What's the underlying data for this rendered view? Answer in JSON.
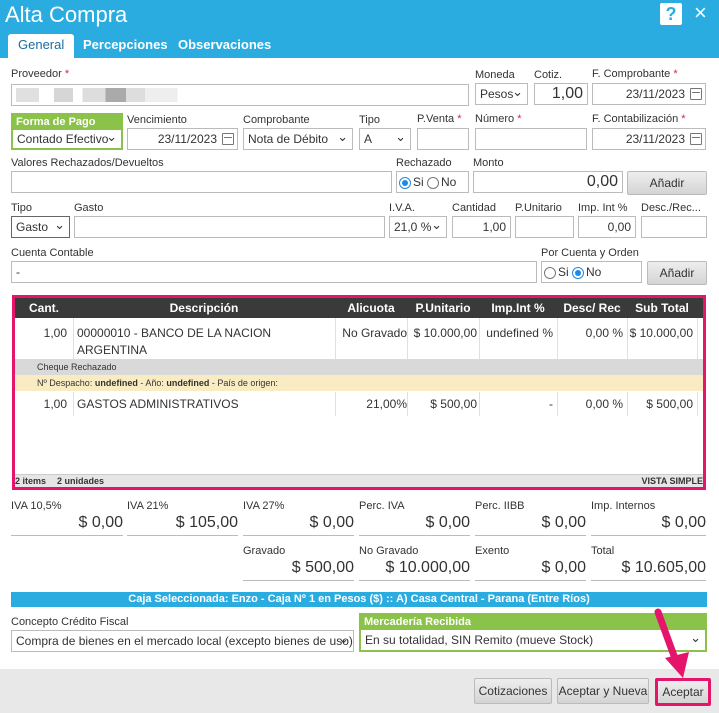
{
  "window": {
    "title": "Alta Compra",
    "help": "?",
    "close": "×"
  },
  "tabs": [
    "General",
    "Percepciones",
    "Observaciones"
  ],
  "labels": {
    "proveedor": "Proveedor",
    "moneda": "Moneda",
    "cotiz": "Cotiz.",
    "fcomp": "F. Comprobante",
    "formapago": "Forma de Pago",
    "venc": "Vencimiento",
    "comprobante": "Comprobante",
    "tipo": "Tipo",
    "pventa": "P.Venta",
    "numero": "Número",
    "fcont": "F. Contabilización",
    "valores": "Valores Rechazados/Devueltos",
    "rechazado": "Rechazado",
    "monto": "Monto",
    "tipo2": "Tipo",
    "gasto": "Gasto",
    "iva": "I.V.A.",
    "cantidad": "Cantidad",
    "punit": "P.Unitario",
    "impint": "Imp. Int %",
    "desc": "Desc./Rec...",
    "cuenta": "Cuenta Contable",
    "porcuenta": "Por Cuenta y Orden",
    "si": "Si",
    "no": "No"
  },
  "values": {
    "moneda": "Pesos",
    "cotiz": "1,00",
    "fcomp": "23/11/2023",
    "formapago": "Contado Efectivo",
    "venc": "23/11/2023",
    "comprobante": "Nota de Débito",
    "tipo": "A",
    "fcont": "23/11/2023",
    "monto": "0,00",
    "tipo2": "Gasto",
    "iva": "21,0 %",
    "cantidad": "1,00",
    "impint": "0,00",
    "cuenta": "-"
  },
  "buttons": {
    "anadir1": "Añadir",
    "anadir2": "Añadir",
    "cotizaciones": "Cotizaciones",
    "aceptarnueva": "Aceptar y Nueva",
    "aceptar": "Aceptar"
  },
  "grid": {
    "headers": [
      "Cant.",
      "Descripción",
      "Alicuota",
      "P.Unitario",
      "Imp.Int %",
      "Desc/ Rec",
      "Sub Total"
    ],
    "row1": {
      "cant": "1,00",
      "desc1": "00000010 - BANCO DE LA NACION",
      "desc2": "ARGENTINA",
      "alic": "No Gravado",
      "punit": "$ 10.000,00",
      "impint": "undefined %",
      "desc": "0,00 %",
      "sub": "$ 10.000,00"
    },
    "cheque": "Cheque Rechazado",
    "despacho": {
      "l1": "Nº Despacho: ",
      "v1": "undefined",
      "l2": " - Año: ",
      "v2": "undefined",
      "l3": " - País de origen:"
    },
    "row2": {
      "cant": "1,00",
      "desc": "GASTOS ADMINISTRATIVOS",
      "alic": "21,00%",
      "punit": "$ 500,00",
      "impint": "-",
      "desc2": "0,00 %",
      "sub": "$ 500,00"
    },
    "footer_items": "2 items",
    "footer_units": "2 unidades",
    "footer_view": "VISTA SIMPLE"
  },
  "totals": {
    "iva105_l": "IVA 10,5%",
    "iva105": "$ 0,00",
    "iva21_l": "IVA 21%",
    "iva21": "$ 105,00",
    "iva27_l": "IVA 27%",
    "iva27": "$ 0,00",
    "perciva_l": "Perc. IVA",
    "perciva": "$ 0,00",
    "perciibb_l": "Perc. IIBB",
    "perciibb": "$ 0,00",
    "impint_l": "Imp. Internos",
    "impint": "$ 0,00",
    "grav_l": "Gravado",
    "grav": "$ 500,00",
    "nograv_l": "No Gravado",
    "nograv": "$ 10.000,00",
    "exento_l": "Exento",
    "exento": "$ 0,00",
    "total_l": "Total",
    "total": "$ 10.605,00"
  },
  "caja": "Caja Seleccionada: Enzo - Caja Nº 1 en Pesos ($) :: A) Casa Central - Parana (Entre Ríos)",
  "concepto": {
    "label": "Concepto Crédito Fiscal",
    "value": "Compra de bienes en el mercado local (excepto bienes de uso)"
  },
  "mercaderia": {
    "label": "Mercadería Recibida",
    "value": "En su totalidad, SIN Remito (mueve Stock)"
  }
}
